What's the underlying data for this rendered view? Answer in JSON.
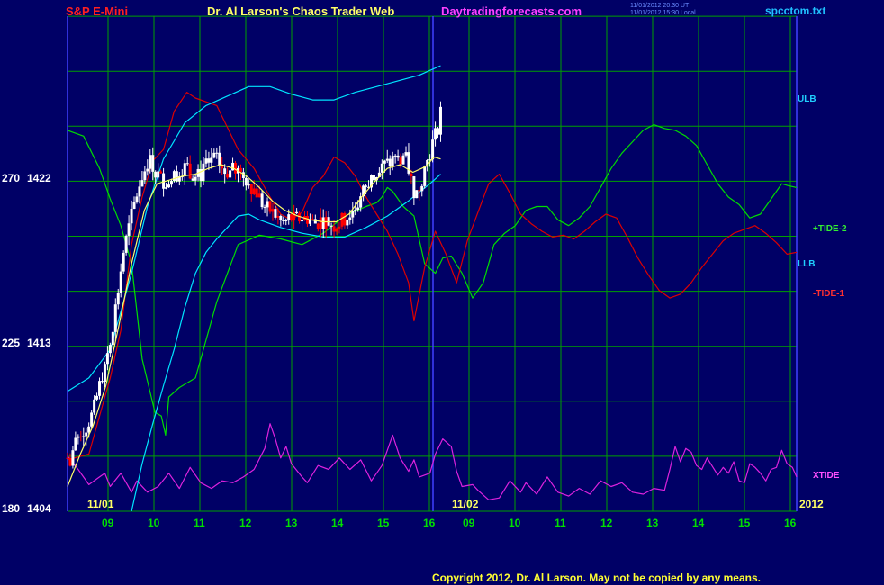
{
  "header": {
    "instrument": "S&P E-Mini",
    "title": "Dr. Al Larson's Chaos Trader Web",
    "site": "Daytradingforecasts.com",
    "stamp_line1": "11/01/2012 20:30 UT",
    "stamp_line2": "11/01/2012 15:30 Local",
    "file": "spcctom.txt"
  },
  "footer": {
    "copyright": "Copyright 2012, Dr. Al Larson. May not be copied by any means."
  },
  "colors": {
    "background": "#000066",
    "grid": "#00a000",
    "frame": "#4040ff",
    "price_up": "#ffffff",
    "price_down": "#ff0000",
    "bands": "#00e5ff",
    "tide1": "#dd0000",
    "tide2": "#00dd00",
    "xtide": "#dd22dd",
    "avg": "#ffff66"
  },
  "chart_data": {
    "type": "line",
    "title": "S&P E-Mini",
    "y_axis": {
      "ticks": [
        {
          "cycle": "180",
          "price": "1404"
        },
        {
          "cycle": "225",
          "price": "1413"
        },
        {
          "cycle": "270",
          "price": "1422"
        }
      ],
      "ylim": [
        1404,
        1430
      ]
    },
    "x_axis": {
      "hour_labels": [
        "09",
        "10",
        "11",
        "12",
        "13",
        "14",
        "15",
        "16",
        "09",
        "10",
        "11",
        "12",
        "13",
        "14",
        "15",
        "16"
      ],
      "date_labels": [
        "11/01",
        "11/02"
      ],
      "year_label": "2012",
      "xlim": [
        "11/01 08:30",
        "11/02 16:10"
      ]
    },
    "now_marker": "11/01 16:15",
    "series": [
      {
        "name": "ULB",
        "style": "cyan band"
      },
      {
        "name": "LLB",
        "style": "cyan band"
      },
      {
        "name": "+TIDE-2",
        "style": "green line"
      },
      {
        "name": "-TIDE-1",
        "style": "red line"
      },
      {
        "name": "XTIDE",
        "style": "magenta line"
      }
    ],
    "price_path": [
      [
        0,
        1406.8
      ],
      [
        2,
        1406.3
      ],
      [
        6,
        1407.4
      ],
      [
        12,
        1408.2
      ],
      [
        18,
        1408.5
      ],
      [
        24,
        1409.2
      ],
      [
        30,
        1410.6
      ],
      [
        36,
        1412.0
      ],
      [
        42,
        1413.6
      ],
      [
        48,
        1415.8
      ],
      [
        52,
        1417.5
      ],
      [
        58,
        1419.0
      ],
      [
        64,
        1420.5
      ],
      [
        70,
        1421.6
      ],
      [
        76,
        1422.5
      ],
      [
        82,
        1422.0
      ],
      [
        88,
        1421.4
      ],
      [
        94,
        1421.3
      ],
      [
        100,
        1421.6
      ],
      [
        106,
        1422.0
      ],
      [
        112,
        1422.1
      ],
      [
        118,
        1421.6
      ],
      [
        124,
        1421.6
      ],
      [
        130,
        1422.1
      ],
      [
        136,
        1422.6
      ],
      [
        142,
        1422.3
      ],
      [
        148,
        1421.8
      ],
      [
        154,
        1421.9
      ],
      [
        160,
        1421.8
      ],
      [
        166,
        1421.6
      ],
      [
        172,
        1421.1
      ],
      [
        178,
        1420.7
      ],
      [
        184,
        1420.0
      ],
      [
        190,
        1419.8
      ],
      [
        196,
        1419.5
      ],
      [
        202,
        1419.1
      ],
      [
        208,
        1419.4
      ],
      [
        214,
        1419.3
      ],
      [
        220,
        1419.4
      ],
      [
        226,
        1419.4
      ],
      [
        232,
        1419.1
      ],
      [
        238,
        1419.3
      ],
      [
        244,
        1419.2
      ],
      [
        250,
        1419.0
      ],
      [
        256,
        1419.2
      ],
      [
        262,
        1419.4
      ],
      [
        268,
        1419.8
      ],
      [
        274,
        1420.3
      ],
      [
        280,
        1421.1
      ],
      [
        286,
        1421.5
      ],
      [
        292,
        1421.8
      ],
      [
        298,
        1422.2
      ],
      [
        304,
        1422.3
      ],
      [
        310,
        1422.5
      ],
      [
        316,
        1422.7
      ],
      [
        322,
        1421.6
      ],
      [
        326,
        1420.5
      ],
      [
        332,
        1421.4
      ],
      [
        336,
        1422.2
      ],
      [
        340,
        1422.9
      ],
      [
        344,
        1423.6
      ],
      [
        348,
        1424.3
      ],
      [
        350,
        1425.0
      ]
    ],
    "ulb_path": [
      [
        0,
        1410.3
      ],
      [
        20,
        1411.0
      ],
      [
        40,
        1412.5
      ],
      [
        60,
        1416.5
      ],
      [
        75,
        1420.0
      ],
      [
        90,
        1422.5
      ],
      [
        110,
        1424.4
      ],
      [
        130,
        1425.3
      ],
      [
        150,
        1425.8
      ],
      [
        170,
        1426.3
      ],
      [
        190,
        1426.3
      ],
      [
        210,
        1425.9
      ],
      [
        230,
        1425.6
      ],
      [
        250,
        1425.6
      ],
      [
        270,
        1426.0
      ],
      [
        290,
        1426.3
      ],
      [
        310,
        1426.6
      ],
      [
        330,
        1426.9
      ],
      [
        350,
        1427.4
      ]
    ],
    "llb_path": [
      [
        60,
        1404.0
      ],
      [
        70,
        1406.5
      ],
      [
        80,
        1408.6
      ],
      [
        90,
        1410.6
      ],
      [
        100,
        1412.5
      ],
      [
        110,
        1414.7
      ],
      [
        120,
        1416.5
      ],
      [
        130,
        1417.6
      ],
      [
        140,
        1418.3
      ],
      [
        150,
        1418.9
      ],
      [
        160,
        1419.5
      ],
      [
        170,
        1419.6
      ],
      [
        180,
        1419.3
      ],
      [
        200,
        1418.9
      ],
      [
        220,
        1418.6
      ],
      [
        240,
        1418.4
      ],
      [
        260,
        1418.4
      ],
      [
        280,
        1418.9
      ],
      [
        300,
        1419.5
      ],
      [
        320,
        1420.3
      ],
      [
        340,
        1421.2
      ],
      [
        350,
        1421.7
      ]
    ],
    "tide2_path": [
      [
        0,
        1424.0
      ],
      [
        15,
        1423.7
      ],
      [
        30,
        1422.0
      ],
      [
        40,
        1420.4
      ],
      [
        50,
        1419.0
      ],
      [
        60,
        1417.0
      ],
      [
        70,
        1412.0
      ],
      [
        82,
        1409.2
      ],
      [
        88,
        1409.0
      ],
      [
        92,
        1408.0
      ],
      [
        95,
        1410.0
      ],
      [
        105,
        1410.5
      ],
      [
        120,
        1411.0
      ],
      [
        140,
        1415.0
      ],
      [
        160,
        1418.0
      ],
      [
        180,
        1418.5
      ],
      [
        200,
        1418.3
      ],
      [
        220,
        1418.0
      ],
      [
        240,
        1418.6
      ],
      [
        260,
        1419.5
      ],
      [
        280,
        1420.0
      ],
      [
        290,
        1420.2
      ],
      [
        295,
        1420.5
      ],
      [
        300,
        1421.0
      ],
      [
        305,
        1420.8
      ],
      [
        315,
        1420.0
      ],
      [
        325,
        1419.5
      ],
      [
        335,
        1417.0
      ],
      [
        345,
        1416.5
      ],
      [
        352,
        1417.3
      ],
      [
        360,
        1417.4
      ],
      [
        370,
        1416.5
      ],
      [
        380,
        1415.2
      ],
      [
        390,
        1416.0
      ],
      [
        400,
        1418.0
      ],
      [
        410,
        1418.6
      ],
      [
        420,
        1419.0
      ],
      [
        430,
        1419.8
      ],
      [
        440,
        1420.0
      ],
      [
        450,
        1420.0
      ],
      [
        460,
        1419.3
      ],
      [
        470,
        1419.0
      ],
      [
        480,
        1419.4
      ],
      [
        490,
        1420.0
      ],
      [
        500,
        1421.0
      ],
      [
        510,
        1422.0
      ],
      [
        520,
        1422.8
      ],
      [
        530,
        1423.4
      ],
      [
        540,
        1424.0
      ],
      [
        550,
        1424.3
      ],
      [
        560,
        1424.1
      ],
      [
        570,
        1424.0
      ],
      [
        580,
        1423.7
      ],
      [
        590,
        1423.2
      ],
      [
        600,
        1422.2
      ],
      [
        610,
        1421.2
      ],
      [
        620,
        1420.5
      ],
      [
        630,
        1420.1
      ],
      [
        640,
        1419.4
      ],
      [
        650,
        1419.6
      ],
      [
        660,
        1420.4
      ],
      [
        670,
        1421.2
      ],
      [
        676,
        1421.1
      ],
      [
        684,
        1421.0
      ]
    ],
    "tide1_path": [
      [
        0,
        1406.7
      ],
      [
        20,
        1407.0
      ],
      [
        40,
        1411.0
      ],
      [
        50,
        1413.5
      ],
      [
        60,
        1418.0
      ],
      [
        70,
        1420.5
      ],
      [
        80,
        1422.4
      ],
      [
        90,
        1423.0
      ],
      [
        100,
        1425.0
      ],
      [
        112,
        1426.0
      ],
      [
        120,
        1425.7
      ],
      [
        140,
        1425.3
      ],
      [
        160,
        1423.0
      ],
      [
        175,
        1422.0
      ],
      [
        190,
        1420.5
      ],
      [
        200,
        1419.6
      ],
      [
        210,
        1419.3
      ],
      [
        220,
        1419.7
      ],
      [
        230,
        1421.0
      ],
      [
        240,
        1421.6
      ],
      [
        250,
        1422.6
      ],
      [
        260,
        1422.3
      ],
      [
        270,
        1421.6
      ],
      [
        280,
        1420.5
      ],
      [
        290,
        1419.6
      ],
      [
        300,
        1418.7
      ],
      [
        310,
        1417.5
      ],
      [
        320,
        1416.0
      ],
      [
        325,
        1414.0
      ],
      [
        335,
        1416.8
      ],
      [
        345,
        1418.7
      ],
      [
        355,
        1417.5
      ],
      [
        365,
        1416.0
      ],
      [
        375,
        1418.2
      ],
      [
        385,
        1419.7
      ],
      [
        395,
        1421.2
      ],
      [
        405,
        1421.7
      ],
      [
        415,
        1420.7
      ],
      [
        425,
        1419.6
      ],
      [
        435,
        1419.1
      ],
      [
        445,
        1418.7
      ],
      [
        455,
        1418.4
      ],
      [
        465,
        1418.5
      ],
      [
        475,
        1418.3
      ],
      [
        485,
        1418.7
      ],
      [
        495,
        1419.2
      ],
      [
        505,
        1419.6
      ],
      [
        515,
        1419.4
      ],
      [
        525,
        1418.4
      ],
      [
        535,
        1417.3
      ],
      [
        545,
        1416.4
      ],
      [
        555,
        1415.6
      ],
      [
        565,
        1415.2
      ],
      [
        575,
        1415.4
      ],
      [
        585,
        1416.0
      ],
      [
        595,
        1416.8
      ],
      [
        605,
        1417.5
      ],
      [
        615,
        1418.2
      ],
      [
        625,
        1418.6
      ],
      [
        635,
        1418.8
      ],
      [
        645,
        1419.0
      ],
      [
        655,
        1418.6
      ],
      [
        665,
        1418.1
      ],
      [
        675,
        1417.5
      ],
      [
        684,
        1417.6
      ]
    ],
    "xtide_path": [
      [
        0,
        1406.9
      ],
      [
        10,
        1406.2
      ],
      [
        20,
        1405.4
      ],
      [
        30,
        1405.8
      ],
      [
        35,
        1406.0
      ],
      [
        40,
        1405.3
      ],
      [
        50,
        1406.0
      ],
      [
        60,
        1405.0
      ],
      [
        65,
        1405.6
      ],
      [
        75,
        1405.0
      ],
      [
        85,
        1405.3
      ],
      [
        95,
        1406.0
      ],
      [
        105,
        1405.2
      ],
      [
        115,
        1406.3
      ],
      [
        125,
        1405.5
      ],
      [
        135,
        1405.2
      ],
      [
        145,
        1405.6
      ],
      [
        155,
        1405.5
      ],
      [
        165,
        1405.8
      ],
      [
        175,
        1406.2
      ],
      [
        185,
        1407.3
      ],
      [
        190,
        1408.6
      ],
      [
        195,
        1407.8
      ],
      [
        200,
        1406.8
      ],
      [
        205,
        1407.4
      ],
      [
        210,
        1406.5
      ],
      [
        220,
        1405.8
      ],
      [
        225,
        1405.5
      ],
      [
        235,
        1406.4
      ],
      [
        245,
        1406.2
      ],
      [
        255,
        1406.8
      ],
      [
        265,
        1406.2
      ],
      [
        275,
        1406.7
      ],
      [
        285,
        1405.6
      ],
      [
        295,
        1406.4
      ],
      [
        305,
        1408.0
      ],
      [
        312,
        1406.8
      ],
      [
        320,
        1406.1
      ],
      [
        325,
        1406.7
      ],
      [
        330,
        1405.8
      ],
      [
        340,
        1406.0
      ],
      [
        345,
        1407.0
      ],
      [
        352,
        1407.8
      ],
      [
        360,
        1407.4
      ],
      [
        365,
        1406.1
      ],
      [
        370,
        1405.3
      ],
      [
        380,
        1405.4
      ],
      [
        385,
        1405.1
      ],
      [
        395,
        1404.6
      ],
      [
        405,
        1404.7
      ],
      [
        415,
        1405.6
      ],
      [
        425,
        1405.0
      ],
      [
        430,
        1405.5
      ],
      [
        440,
        1404.9
      ],
      [
        450,
        1405.8
      ],
      [
        460,
        1405.0
      ],
      [
        470,
        1404.8
      ],
      [
        480,
        1405.2
      ],
      [
        490,
        1404.9
      ],
      [
        500,
        1405.6
      ],
      [
        510,
        1405.3
      ],
      [
        520,
        1405.5
      ],
      [
        530,
        1405.0
      ],
      [
        540,
        1404.9
      ],
      [
        550,
        1405.2
      ],
      [
        560,
        1405.1
      ],
      [
        565,
        1406.2
      ],
      [
        570,
        1407.4
      ],
      [
        575,
        1406.6
      ],
      [
        580,
        1407.3
      ],
      [
        585,
        1407.1
      ],
      [
        590,
        1406.4
      ],
      [
        595,
        1406.2
      ],
      [
        600,
        1406.8
      ],
      [
        610,
        1405.9
      ],
      [
        615,
        1406.3
      ],
      [
        620,
        1406.0
      ],
      [
        625,
        1406.6
      ],
      [
        630,
        1405.6
      ],
      [
        635,
        1405.5
      ],
      [
        640,
        1406.5
      ],
      [
        645,
        1406.3
      ],
      [
        650,
        1406.0
      ],
      [
        655,
        1405.6
      ],
      [
        660,
        1406.2
      ],
      [
        665,
        1406.3
      ],
      [
        670,
        1407.2
      ],
      [
        675,
        1406.5
      ],
      [
        680,
        1406.3
      ],
      [
        684,
        1405.8
      ]
    ],
    "avg_path": [
      [
        0,
        1405.3
      ],
      [
        12,
        1407.0
      ],
      [
        24,
        1408.5
      ],
      [
        36,
        1410.6
      ],
      [
        48,
        1413.7
      ],
      [
        60,
        1417.0
      ],
      [
        72,
        1419.8
      ],
      [
        84,
        1421.2
      ],
      [
        96,
        1421.4
      ],
      [
        108,
        1421.6
      ],
      [
        120,
        1421.7
      ],
      [
        132,
        1422.0
      ],
      [
        144,
        1422.2
      ],
      [
        156,
        1422.0
      ],
      [
        168,
        1421.6
      ],
      [
        180,
        1421.0
      ],
      [
        192,
        1420.3
      ],
      [
        204,
        1419.8
      ],
      [
        216,
        1419.5
      ],
      [
        228,
        1419.3
      ],
      [
        240,
        1419.2
      ],
      [
        252,
        1419.2
      ],
      [
        264,
        1419.6
      ],
      [
        276,
        1420.5
      ],
      [
        288,
        1421.3
      ],
      [
        300,
        1422.0
      ],
      [
        312,
        1422.2
      ],
      [
        324,
        1421.8
      ],
      [
        336,
        1422.1
      ],
      [
        344,
        1422.6
      ],
      [
        350,
        1422.5
      ]
    ]
  }
}
